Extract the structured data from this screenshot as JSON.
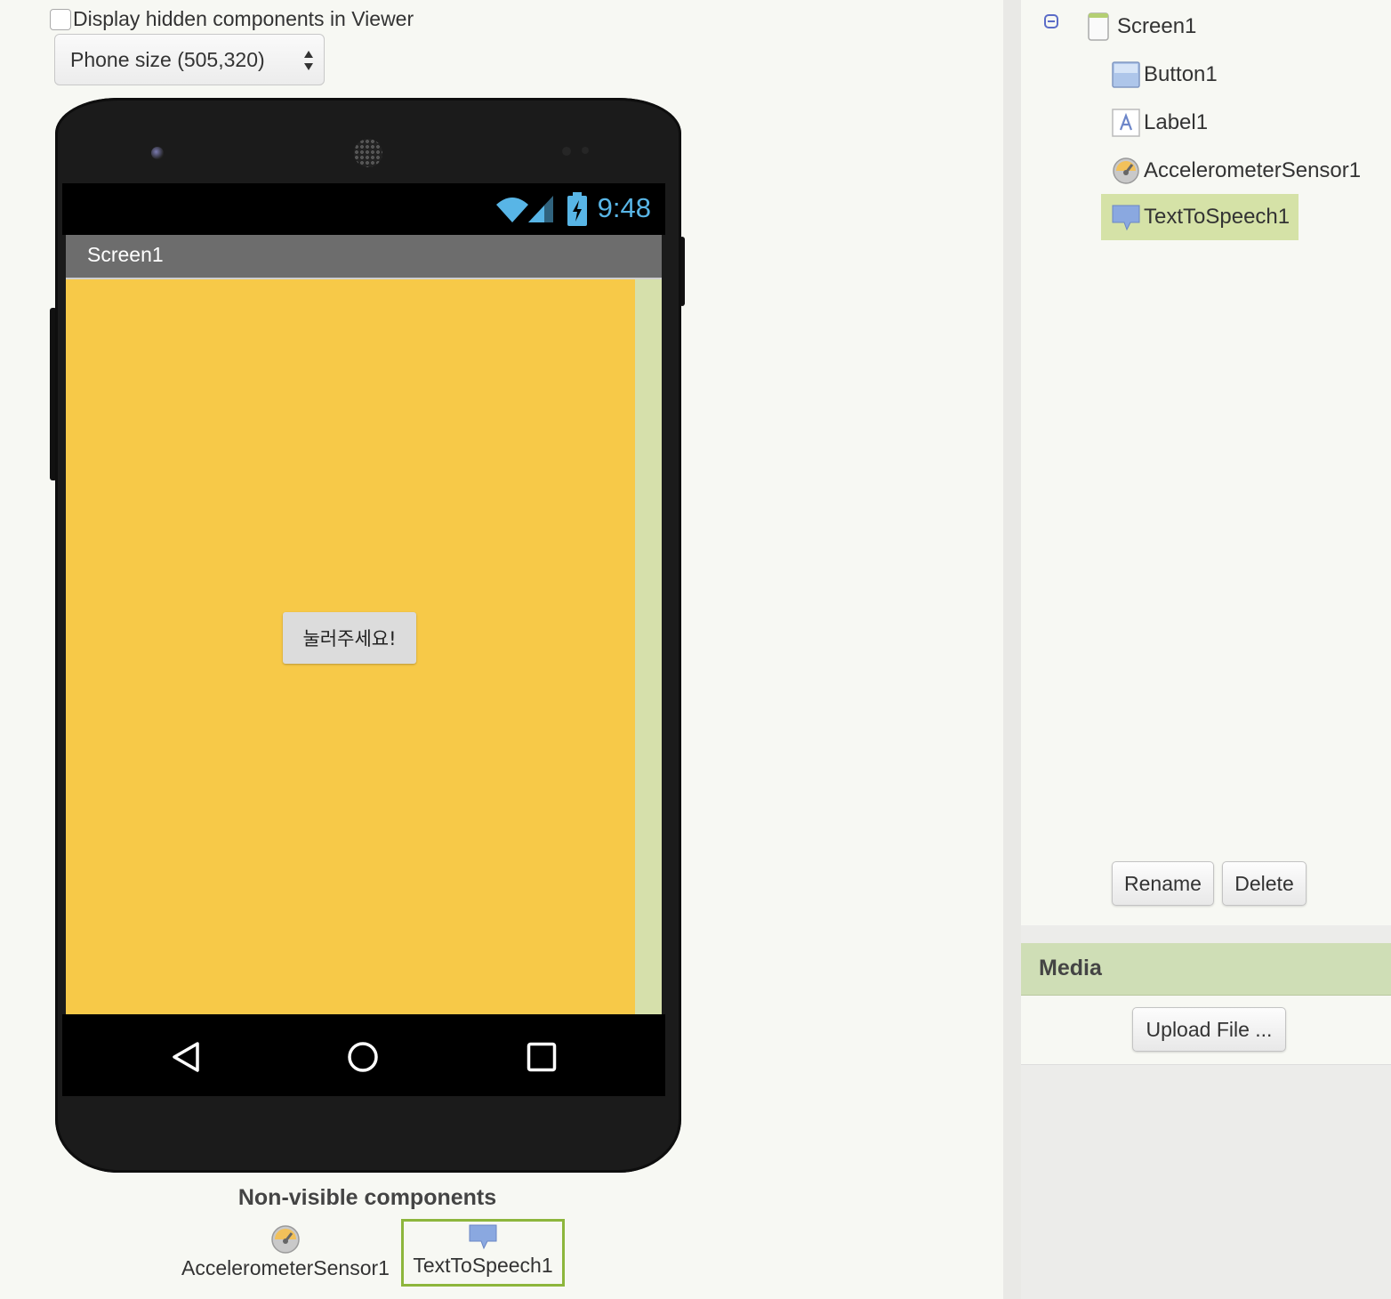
{
  "viewer": {
    "hidden_components_label": "Display hidden components in Viewer",
    "hidden_components_checked": false,
    "size_select": "Phone size (505,320)"
  },
  "phone": {
    "status_time": "9:48",
    "screen_title": "Screen1",
    "button_text": "눌러주세요!",
    "screen_color": "#f7c948"
  },
  "non_visible": {
    "title": "Non-visible components",
    "items": [
      {
        "label": "AccelerometerSensor1",
        "icon": "accelerometer-icon"
      },
      {
        "label": "TextToSpeech1",
        "icon": "speech-bubble-icon"
      }
    ]
  },
  "components": {
    "tree": [
      {
        "label": "Screen1",
        "icon": "screen-icon"
      },
      {
        "label": "Button1",
        "icon": "button-icon"
      },
      {
        "label": "Label1",
        "icon": "label-icon"
      },
      {
        "label": "AccelerometerSensor1",
        "icon": "accelerometer-icon"
      },
      {
        "label": "TextToSpeech1",
        "icon": "speech-bubble-icon",
        "selected": true
      }
    ],
    "rename_label": "Rename",
    "delete_label": "Delete"
  },
  "media": {
    "title": "Media",
    "upload_label": "Upload File ..."
  },
  "colors": {
    "selection": "#d5e2a7",
    "media_header": "#cfdeb6",
    "status_text": "#58b5e6"
  }
}
